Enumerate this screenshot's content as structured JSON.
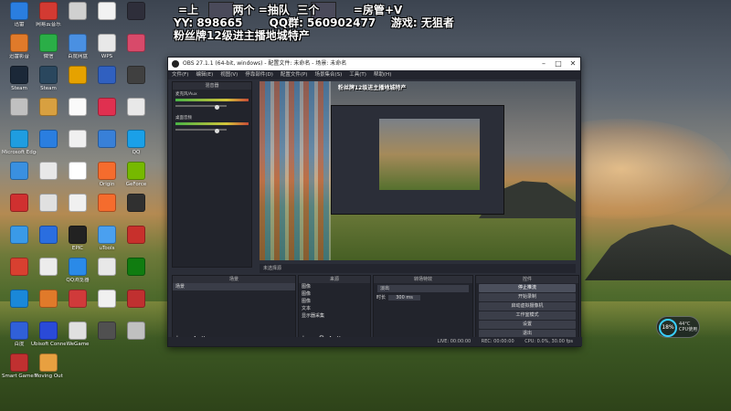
{
  "overlay": {
    "line1_a": "=上",
    "line1_b": "两个",
    "line1_c": "=抽队",
    "line1_d": "三个",
    "line1_e": "=房管+V",
    "line2": "YY: 898665",
    "line2_qq": "QQ群: 560902477",
    "line2_game": "游戏: 无狙者",
    "line3": "粉丝牌12级进主播地城特产"
  },
  "desktop_icons": [
    {
      "label": "迅雷",
      "color": "#2a7ee0"
    },
    {
      "label": "网易云音乐",
      "color": "#d33a32"
    },
    {
      "label": "",
      "color": "#d0d0d0"
    },
    {
      "label": "",
      "color": "#f2f2f2"
    },
    {
      "label": "",
      "color": "#2e2e3a"
    },
    {
      "label": "迅雷影音",
      "color": "#e07a2a"
    },
    {
      "label": "微信",
      "color": "#2aae47"
    },
    {
      "label": "百度网盘",
      "color": "#4a90e2"
    },
    {
      "label": "WPS",
      "color": "#e8e8e8"
    },
    {
      "label": "",
      "color": "#d84a6a"
    },
    {
      "label": "Steam",
      "color": "#1b2838"
    },
    {
      "label": "Steam",
      "color": "#2a475e"
    },
    {
      "label": "",
      "color": "#e6a200"
    },
    {
      "label": "",
      "color": "#3060c0"
    },
    {
      "label": "",
      "color": "#404040"
    },
    {
      "label": "",
      "color": "#c0c0c0"
    },
    {
      "label": "",
      "color": "#d8a040"
    },
    {
      "label": "",
      "color": "#fafafa"
    },
    {
      "label": "",
      "color": "#e03050"
    },
    {
      "label": "",
      "color": "#e8e8e8"
    },
    {
      "label": "Microsoft Edge",
      "color": "#1f9de0"
    },
    {
      "label": "",
      "color": "#2a7ee0"
    },
    {
      "label": "",
      "color": "#f0f0f0"
    },
    {
      "label": "",
      "color": "#3880d8"
    },
    {
      "label": "QQ",
      "color": "#1aa0e8"
    },
    {
      "label": "",
      "color": "#3a90e0"
    },
    {
      "label": "",
      "color": "#e8e8e8"
    },
    {
      "label": "",
      "color": "#ffffff"
    },
    {
      "label": "Origin",
      "color": "#f56c2d"
    },
    {
      "label": "GeForce",
      "color": "#76b900"
    },
    {
      "label": "",
      "color": "#d03030"
    },
    {
      "label": "",
      "color": "#e0e0e0"
    },
    {
      "label": "",
      "color": "#f0f0f0"
    },
    {
      "label": "",
      "color": "#f56c2d"
    },
    {
      "label": "",
      "color": "#303030"
    },
    {
      "label": "",
      "color": "#3a9ae8"
    },
    {
      "label": "",
      "color": "#2a6ee0"
    },
    {
      "label": "EPIC",
      "color": "#222222"
    },
    {
      "label": "uTools",
      "color": "#4aa0f0"
    },
    {
      "label": "",
      "color": "#c8302c"
    },
    {
      "label": "",
      "color": "#d84030"
    },
    {
      "label": "",
      "color": "#ececec"
    },
    {
      "label": "QQ浏览器",
      "color": "#2a8ae8"
    },
    {
      "label": "",
      "color": "#e8e8e8"
    },
    {
      "label": "",
      "color": "#107c10"
    },
    {
      "label": "",
      "color": "#1a88d8"
    },
    {
      "label": "",
      "color": "#e07a2a"
    },
    {
      "label": "",
      "color": "#d03a3a"
    },
    {
      "label": "",
      "color": "#f0f0f0"
    },
    {
      "label": "",
      "color": "#c03030"
    },
    {
      "label": "百度",
      "color": "#3060d8"
    },
    {
      "label": "Ubisoft Connect",
      "color": "#2a4ad8"
    },
    {
      "label": "WeGame",
      "color": "#e0e0e0"
    },
    {
      "label": "",
      "color": "#505050"
    },
    {
      "label": "",
      "color": "#c0c0c0"
    },
    {
      "label": "Smart Game Booster",
      "color": "#c03030"
    },
    {
      "label": "Moving Out",
      "color": "#e8a040"
    }
  ],
  "obs": {
    "title": "OBS 27.1.1 (64-bit, windows) - 配置文件: 未命名 - 场景: 未命名",
    "menu": [
      "文件(F)",
      "编辑(E)",
      "视图(V)",
      "停靠部件(D)",
      "配置文件(P)",
      "场景集合(S)",
      "工具(T)",
      "帮助(H)"
    ],
    "mixer_title": "混音器",
    "mixer_channels": [
      {
        "name": "麦克风/Aux"
      },
      {
        "name": "桌面音频"
      }
    ],
    "preview_overlay": "粉丝牌12级进主播地城特产",
    "scene_bar": "未选择源",
    "docks": {
      "scenes": {
        "title": "场景",
        "items": [
          "场景"
        ]
      },
      "sources": {
        "title": "来源",
        "items": [
          "图像",
          "图像",
          "图像",
          "文本",
          "显示器采集"
        ]
      },
      "transitions": {
        "title": "转场特效",
        "mode": "淡出",
        "duration_label": "时长",
        "duration": "300 ms"
      },
      "controls": {
        "title": "控件",
        "buttons": [
          "停止推流",
          "开始录制",
          "启动虚拟摄像机",
          "工作室模式",
          "设置",
          "退出"
        ]
      }
    },
    "status": {
      "live": "LIVE: 00:00:00",
      "rec": "REC: 00:00:00",
      "cpu": "CPU: 0.0%, 30.00 fps"
    }
  },
  "cpu_widget": {
    "percent": "18%",
    "temp": "44°C",
    "label": "CPU使用"
  }
}
